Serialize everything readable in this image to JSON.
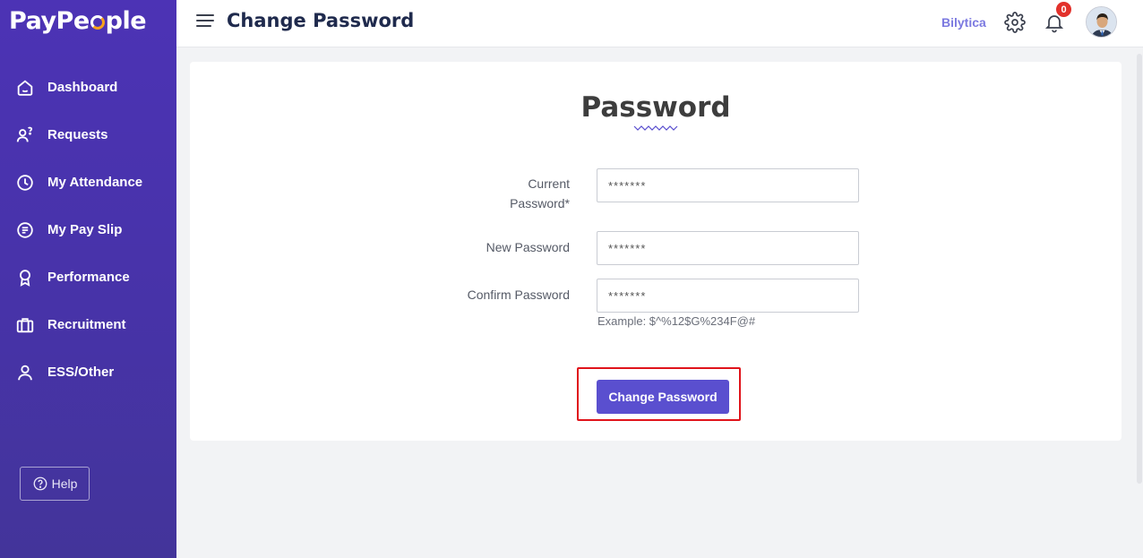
{
  "app": {
    "logo_text_start": "PayPe",
    "logo_text_end": "ple",
    "brand_accent": "#f7a21b"
  },
  "sidebar": {
    "background": "#4a33b0",
    "items": [
      {
        "label": "Dashboard",
        "icon": "home-icon"
      },
      {
        "label": "Requests",
        "icon": "request-user-icon"
      },
      {
        "label": "My Attendance",
        "icon": "clock-icon"
      },
      {
        "label": "My Pay Slip",
        "icon": "payslip-icon"
      },
      {
        "label": "Performance",
        "icon": "award-icon"
      },
      {
        "label": "Recruitment",
        "icon": "briefcase-icon"
      },
      {
        "label": "ESS/Other",
        "icon": "person-icon"
      }
    ],
    "help_label": "Help"
  },
  "header": {
    "title": "Change Password",
    "company": "Bilytica",
    "notification_count": "0"
  },
  "form": {
    "heading": "Password",
    "current_password": {
      "label": "Current Password*",
      "value": "*******"
    },
    "new_password": {
      "label": "New Password",
      "value": "*******"
    },
    "confirm_password": {
      "label": "Confirm Password",
      "value": "*******"
    },
    "hint": "Example: $^%12$G%234F@#",
    "submit_label": "Change Password",
    "accent": "#5a4fcf"
  }
}
